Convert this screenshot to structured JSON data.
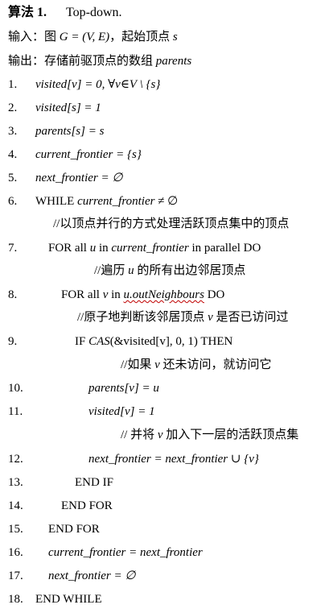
{
  "title": {
    "label": "算法 1.",
    "text": "Top-down."
  },
  "input": {
    "prefix": "输入：图 ",
    "graph": "G = (V, E)",
    "suffix": "，起始顶点 ",
    "start": "s"
  },
  "output": {
    "prefix": "输出：存储前驱顶点的数组 ",
    "var": "parents"
  },
  "lines": [
    {
      "num": "1.",
      "code": "visited[v] = 0, ∀v∈V \\ {s}"
    },
    {
      "num": "2.",
      "code": "visited[s] = 1"
    },
    {
      "num": "3.",
      "code": "parents[s] = s"
    },
    {
      "num": "4.",
      "code": "current_frontier = {s}"
    },
    {
      "num": "5.",
      "code": "next_frontier = ∅"
    },
    {
      "num": "6.",
      "code_prefix": "WHILE ",
      "code_italic": "current_frontier",
      "code_suffix": " ≠ ∅"
    },
    {
      "num": "7.",
      "code_prefix": "FOR all ",
      "code_italic": "u",
      "code_mid": " in ",
      "code_italic2": "current_frontier",
      "code_suffix": " in parallel DO"
    },
    {
      "num": "8.",
      "code_prefix": "FOR all ",
      "code_italic": "v",
      "code_mid": " in ",
      "code_italic2": "u.outNeighbours",
      "code_suffix": " DO"
    },
    {
      "num": "9.",
      "code_prefix": "IF ",
      "code_italic": "CAS",
      "code_suffix": "(&visited[v], 0, 1) THEN"
    },
    {
      "num": "10.",
      "code": "parents[v] = u"
    },
    {
      "num": "11.",
      "code": "visited[v] = 1"
    },
    {
      "num": "12.",
      "code": "next_frontier = next_frontier ∪ {v}"
    },
    {
      "num": "13.",
      "code": "END IF"
    },
    {
      "num": "14.",
      "code": "END FOR"
    },
    {
      "num": "15.",
      "code": "END FOR"
    },
    {
      "num": "16.",
      "code": "current_frontier = next_frontier"
    },
    {
      "num": "17.",
      "code": "next_frontier = ∅"
    },
    {
      "num": "18.",
      "code": "END WHILE"
    }
  ],
  "comments": {
    "c1": "//以顶点并行的方式处理活跃顶点集中的顶点",
    "c2_pre": "//遍历 ",
    "c2_var": "u",
    "c2_post": " 的所有出边邻居顶点",
    "c3_pre": "//原子地判断该邻居顶点 ",
    "c3_var": "v",
    "c3_post": " 是否已访问过",
    "c4_pre": "//如果 ",
    "c4_var": "v",
    "c4_post": " 还未访问，就访问它",
    "c5_pre": "//  并将 ",
    "c5_var": "v",
    "c5_post": " 加入下一层的活跃顶点集"
  }
}
